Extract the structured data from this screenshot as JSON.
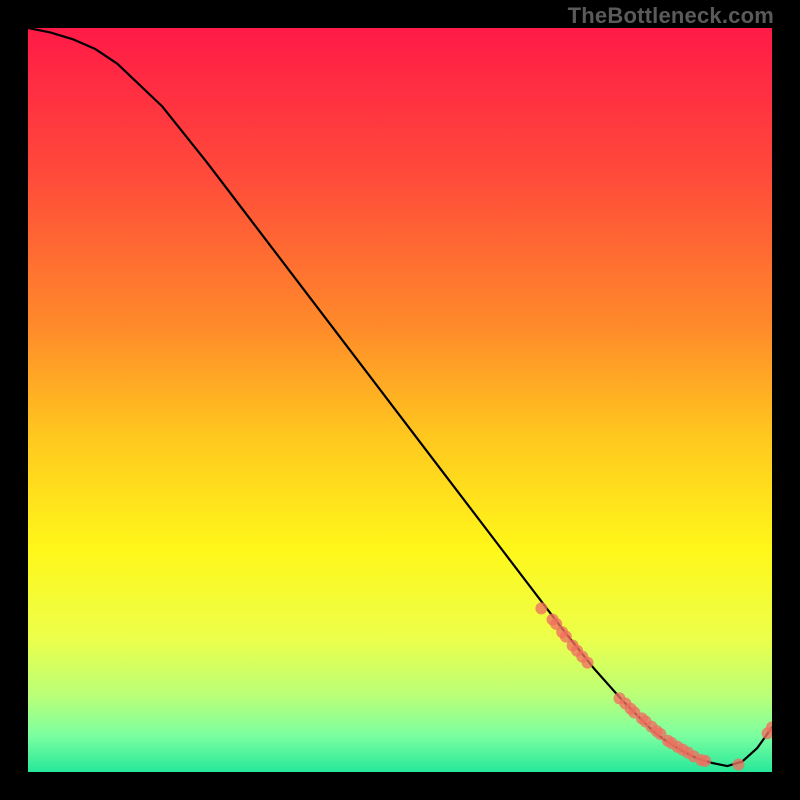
{
  "watermark": "TheBottleneck.com",
  "chart_data": {
    "type": "line",
    "title": "",
    "xlabel": "",
    "ylabel": "",
    "xlim": [
      0,
      100
    ],
    "ylim": [
      0,
      100
    ],
    "grid": false,
    "legend": false,
    "gradient_stops": [
      {
        "offset": 0.0,
        "color": "#ff1a47"
      },
      {
        "offset": 0.2,
        "color": "#ff4b3a"
      },
      {
        "offset": 0.4,
        "color": "#ff8a2a"
      },
      {
        "offset": 0.55,
        "color": "#ffc81e"
      },
      {
        "offset": 0.7,
        "color": "#fff71a"
      },
      {
        "offset": 0.82,
        "color": "#ecff4a"
      },
      {
        "offset": 0.9,
        "color": "#b8ff7a"
      },
      {
        "offset": 0.95,
        "color": "#7dffa0"
      },
      {
        "offset": 1.0,
        "color": "#26e89a"
      }
    ],
    "series": [
      {
        "name": "curve",
        "type": "line",
        "color": "#000000",
        "x": [
          0,
          3,
          6,
          9,
          12,
          18,
          24,
          32,
          40,
          48,
          56,
          64,
          72,
          76,
          80,
          84,
          86,
          88,
          90,
          92,
          94,
          96,
          98,
          100
        ],
        "y": [
          100,
          99.4,
          98.5,
          97.2,
          95.2,
          89.5,
          82.0,
          71.5,
          61.0,
          50.5,
          40.0,
          29.5,
          19.0,
          14.0,
          9.5,
          5.5,
          4.0,
          2.8,
          1.8,
          1.2,
          0.8,
          1.4,
          3.2,
          6.0
        ]
      },
      {
        "name": "dots",
        "type": "scatter",
        "color": "#f07060",
        "radius": 6,
        "x": [
          69,
          70.5,
          71,
          71.8,
          72.3,
          73.2,
          73.8,
          74.5,
          75.2,
          79.5,
          80.3,
          81,
          81.5,
          82.5,
          83,
          83.8,
          84.5,
          85,
          86,
          86.5,
          87.3,
          88,
          88.7,
          89.5,
          90.5,
          91,
          95.5,
          99.4,
          100
        ],
        "y": [
          22,
          20.5,
          19.9,
          18.8,
          18.2,
          17.0,
          16.3,
          15.5,
          14.7,
          9.9,
          9.2,
          8.5,
          8.0,
          7.2,
          6.8,
          6.1,
          5.5,
          5.1,
          4.2,
          3.9,
          3.4,
          3.0,
          2.6,
          2.1,
          1.6,
          1.5,
          1.0,
          5.2,
          6.0
        ]
      }
    ]
  }
}
